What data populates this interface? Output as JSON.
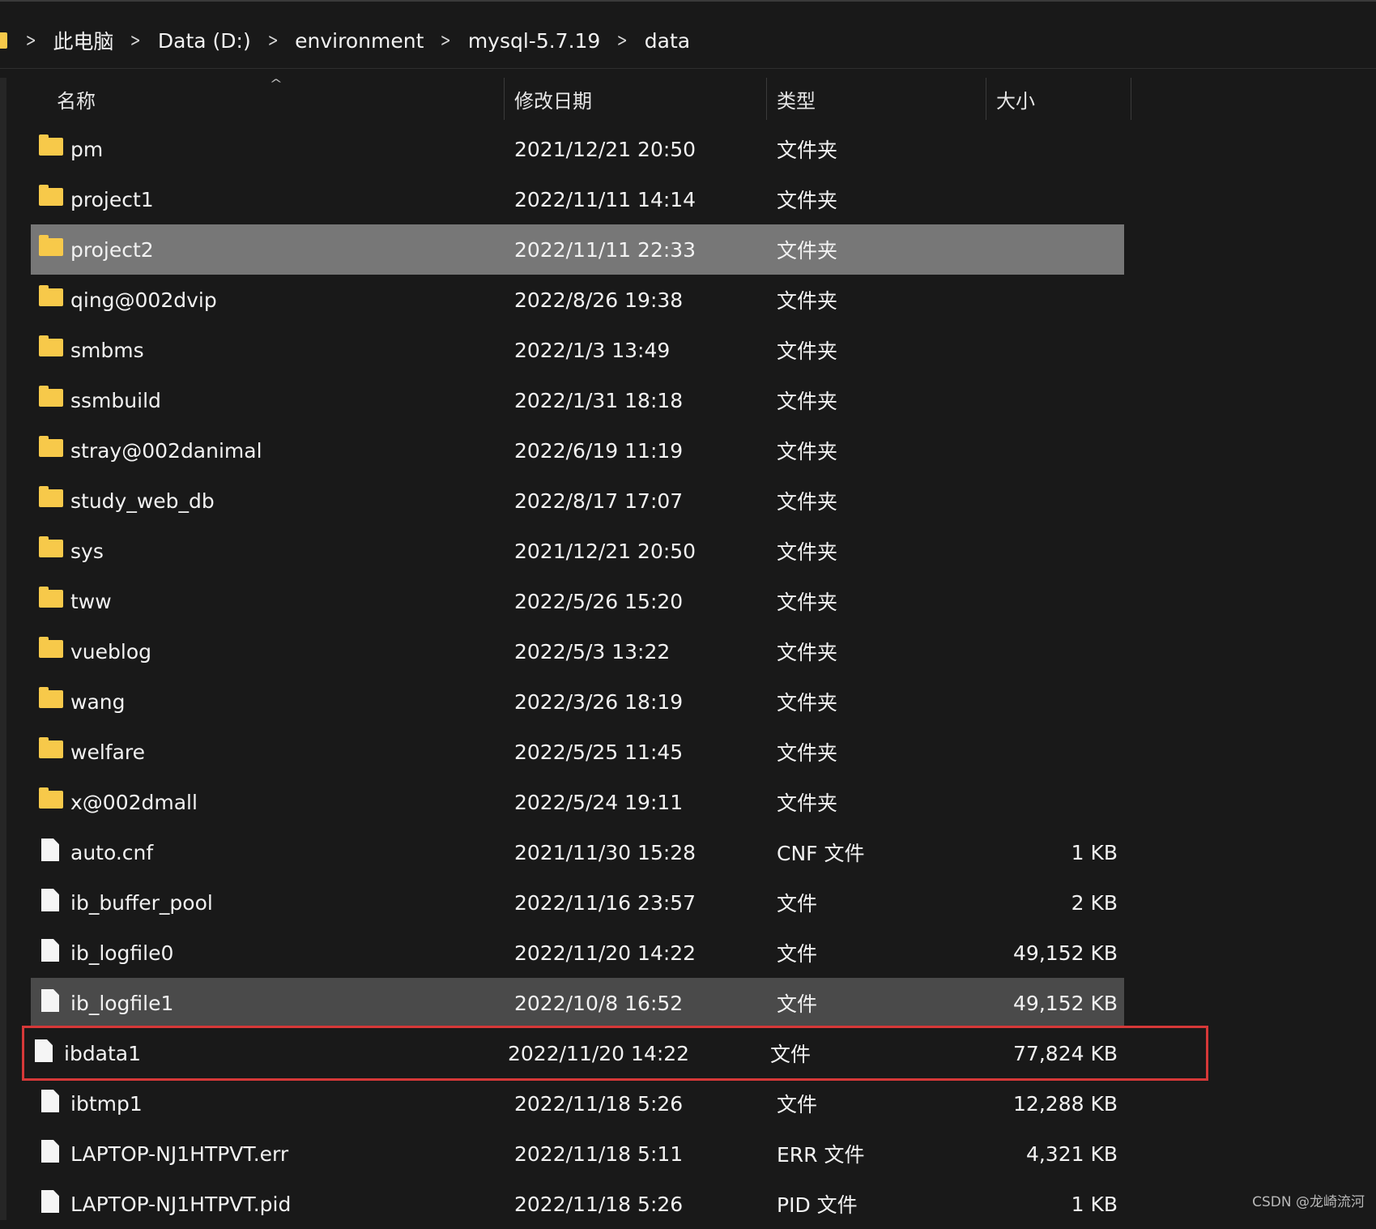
{
  "breadcrumb": [
    "此电脑",
    "Data (D:)",
    "environment",
    "mysql-5.7.19",
    "data"
  ],
  "columns": {
    "name": "名称",
    "date": "修改日期",
    "type": "类型",
    "size": "大小"
  },
  "files": [
    {
      "name": "pm",
      "date": "2021/12/21 20:50",
      "type": "文件夹",
      "size": "",
      "icon": "folder-icon"
    },
    {
      "name": "project1",
      "date": "2022/11/11 14:14",
      "type": "文件夹",
      "size": "",
      "icon": "folder-icon"
    },
    {
      "name": "project2",
      "date": "2022/11/11 22:33",
      "type": "文件夹",
      "size": "",
      "icon": "folder-icon",
      "state": "selected"
    },
    {
      "name": "qing@002dvip",
      "date": "2022/8/26 19:38",
      "type": "文件夹",
      "size": "",
      "icon": "folder-icon"
    },
    {
      "name": "smbms",
      "date": "2022/1/3 13:49",
      "type": "文件夹",
      "size": "",
      "icon": "folder-icon"
    },
    {
      "name": "ssmbuild",
      "date": "2022/1/31 18:18",
      "type": "文件夹",
      "size": "",
      "icon": "folder-icon"
    },
    {
      "name": "stray@002danimal",
      "date": "2022/6/19 11:19",
      "type": "文件夹",
      "size": "",
      "icon": "folder-icon"
    },
    {
      "name": "study_web_db",
      "date": "2022/8/17 17:07",
      "type": "文件夹",
      "size": "",
      "icon": "folder-icon"
    },
    {
      "name": "sys",
      "date": "2021/12/21 20:50",
      "type": "文件夹",
      "size": "",
      "icon": "folder-icon"
    },
    {
      "name": "tww",
      "date": "2022/5/26 15:20",
      "type": "文件夹",
      "size": "",
      "icon": "folder-icon"
    },
    {
      "name": "vueblog",
      "date": "2022/5/3 13:22",
      "type": "文件夹",
      "size": "",
      "icon": "folder-icon"
    },
    {
      "name": "wang",
      "date": "2022/3/26 18:19",
      "type": "文件夹",
      "size": "",
      "icon": "folder-icon"
    },
    {
      "name": "welfare",
      "date": "2022/5/25 11:45",
      "type": "文件夹",
      "size": "",
      "icon": "folder-icon"
    },
    {
      "name": "x@002dmall",
      "date": "2022/5/24 19:11",
      "type": "文件夹",
      "size": "",
      "icon": "folder-icon"
    },
    {
      "name": "auto.cnf",
      "date": "2021/11/30 15:28",
      "type": "CNF 文件",
      "size": "1 KB",
      "icon": "file-icon"
    },
    {
      "name": "ib_buffer_pool",
      "date": "2022/11/16 23:57",
      "type": "文件",
      "size": "2 KB",
      "icon": "file-icon"
    },
    {
      "name": "ib_logfile0",
      "date": "2022/11/20 14:22",
      "type": "文件",
      "size": "49,152 KB",
      "icon": "file-icon"
    },
    {
      "name": "ib_logfile1",
      "date": "2022/10/8 16:52",
      "type": "文件",
      "size": "49,152 KB",
      "icon": "file-icon",
      "state": "hover"
    },
    {
      "name": "ibdata1",
      "date": "2022/11/20 14:22",
      "type": "文件",
      "size": "77,824 KB",
      "icon": "file-icon",
      "state": "flagged"
    },
    {
      "name": "ibtmp1",
      "date": "2022/11/18 5:26",
      "type": "文件",
      "size": "12,288 KB",
      "icon": "file-icon"
    },
    {
      "name": "LAPTOP-NJ1HTPVT.err",
      "date": "2022/11/18 5:11",
      "type": "ERR 文件",
      "size": "4,321 KB",
      "icon": "file-icon"
    },
    {
      "name": "LAPTOP-NJ1HTPVT.pid",
      "date": "2022/11/18 5:26",
      "type": "PID 文件",
      "size": "1 KB",
      "icon": "file-icon"
    }
  ],
  "watermark": "CSDN @龙崎流河",
  "colors": {
    "background": "#191919",
    "folder": "#f7c94a",
    "selected_row": "#777777",
    "hover_row": "#4a4a4a",
    "highlight_box": "#d63838"
  }
}
